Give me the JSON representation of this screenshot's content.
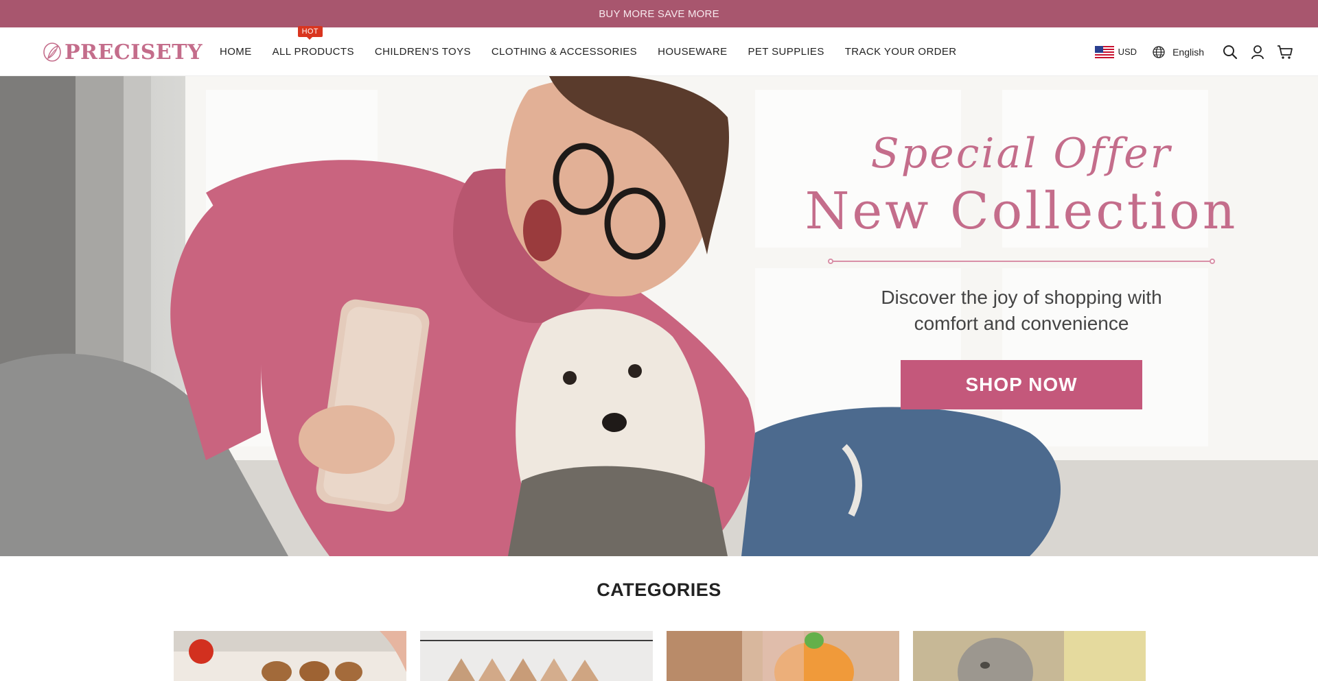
{
  "announcement": "BUY MORE SAVE MORE",
  "logo": {
    "text": "PRECISETY"
  },
  "nav": {
    "items": [
      {
        "label": "HOME"
      },
      {
        "label": "ALL PRODUCTS",
        "badge": "HOT"
      },
      {
        "label": "CHILDREN'S TOYS"
      },
      {
        "label": "CLOTHING & ACCESSORIES"
      },
      {
        "label": "HOUSEWARE"
      },
      {
        "label": "PET SUPPLIES"
      },
      {
        "label": "TRACK YOUR ORDER"
      }
    ]
  },
  "header_right": {
    "currency": "USD",
    "language": "English",
    "icons": [
      "globe-icon",
      "search-icon",
      "account-icon",
      "cart-icon"
    ]
  },
  "hero": {
    "special": "Special Offer",
    "title": "New Collection",
    "tagline_line1": "Discover the joy of shopping with",
    "tagline_line2": "comfort and convenience",
    "button": "SHOP NOW"
  },
  "categories": {
    "title": "CATEGORIES",
    "cards": [
      "kitchen-category",
      "clothing-category",
      "toys-category",
      "pet-category"
    ]
  },
  "colors": {
    "accent": "#c4587b",
    "brand": "#c46d8b",
    "announce_bg": "#a8566e",
    "hot_badge": "#d9351f"
  }
}
